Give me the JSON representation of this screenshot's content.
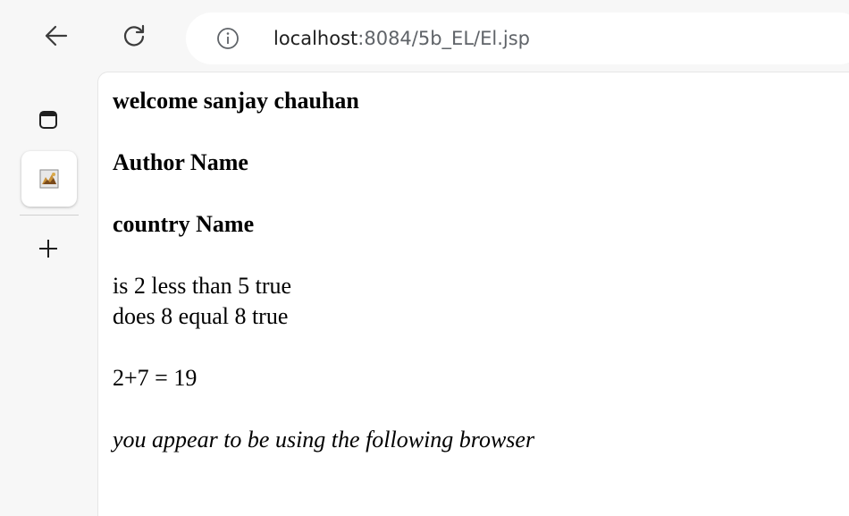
{
  "browser": {
    "url_host": "localhost",
    "url_path": ":8084/5b_EL/El.jsp",
    "nav": {
      "back_icon": "arrow-left-icon",
      "reload_icon": "reload-icon",
      "info_icon": "info-icon"
    },
    "vertical_tabs": {
      "tab_actions_icon": "tab-actions-icon",
      "tabs": [
        {
          "icon": "tomcat-favicon-icon",
          "active": true
        }
      ],
      "new_tab_icon": "plus-icon"
    }
  },
  "page": {
    "welcome": "welcome sanjay chauhan",
    "author": "Author Name",
    "country": "country Name",
    "compare_less": "is 2 less than 5 true",
    "compare_equal": "does 8 equal 8 true",
    "sum": "2+7 = 19",
    "browser_line": "you appear to be using the following browser"
  }
}
